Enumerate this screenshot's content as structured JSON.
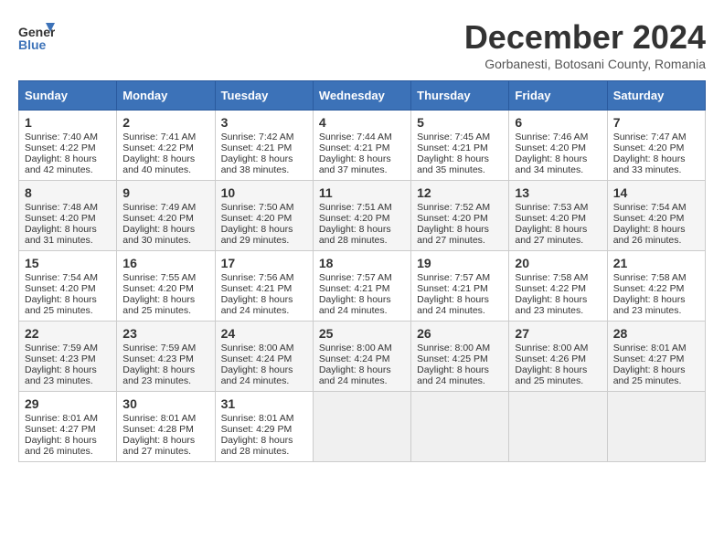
{
  "header": {
    "logo_line1": "General",
    "logo_line2": "Blue",
    "month": "December 2024",
    "location": "Gorbanesti, Botosani County, Romania"
  },
  "columns": [
    "Sunday",
    "Monday",
    "Tuesday",
    "Wednesday",
    "Thursday",
    "Friday",
    "Saturday"
  ],
  "weeks": [
    [
      {
        "day": "1",
        "lines": [
          "Sunrise: 7:40 AM",
          "Sunset: 4:22 PM",
          "Daylight: 8 hours",
          "and 42 minutes."
        ]
      },
      {
        "day": "2",
        "lines": [
          "Sunrise: 7:41 AM",
          "Sunset: 4:22 PM",
          "Daylight: 8 hours",
          "and 40 minutes."
        ]
      },
      {
        "day": "3",
        "lines": [
          "Sunrise: 7:42 AM",
          "Sunset: 4:21 PM",
          "Daylight: 8 hours",
          "and 38 minutes."
        ]
      },
      {
        "day": "4",
        "lines": [
          "Sunrise: 7:44 AM",
          "Sunset: 4:21 PM",
          "Daylight: 8 hours",
          "and 37 minutes."
        ]
      },
      {
        "day": "5",
        "lines": [
          "Sunrise: 7:45 AM",
          "Sunset: 4:21 PM",
          "Daylight: 8 hours",
          "and 35 minutes."
        ]
      },
      {
        "day": "6",
        "lines": [
          "Sunrise: 7:46 AM",
          "Sunset: 4:20 PM",
          "Daylight: 8 hours",
          "and 34 minutes."
        ]
      },
      {
        "day": "7",
        "lines": [
          "Sunrise: 7:47 AM",
          "Sunset: 4:20 PM",
          "Daylight: 8 hours",
          "and 33 minutes."
        ]
      }
    ],
    [
      {
        "day": "8",
        "lines": [
          "Sunrise: 7:48 AM",
          "Sunset: 4:20 PM",
          "Daylight: 8 hours",
          "and 31 minutes."
        ]
      },
      {
        "day": "9",
        "lines": [
          "Sunrise: 7:49 AM",
          "Sunset: 4:20 PM",
          "Daylight: 8 hours",
          "and 30 minutes."
        ]
      },
      {
        "day": "10",
        "lines": [
          "Sunrise: 7:50 AM",
          "Sunset: 4:20 PM",
          "Daylight: 8 hours",
          "and 29 minutes."
        ]
      },
      {
        "day": "11",
        "lines": [
          "Sunrise: 7:51 AM",
          "Sunset: 4:20 PM",
          "Daylight: 8 hours",
          "and 28 minutes."
        ]
      },
      {
        "day": "12",
        "lines": [
          "Sunrise: 7:52 AM",
          "Sunset: 4:20 PM",
          "Daylight: 8 hours",
          "and 27 minutes."
        ]
      },
      {
        "day": "13",
        "lines": [
          "Sunrise: 7:53 AM",
          "Sunset: 4:20 PM",
          "Daylight: 8 hours",
          "and 27 minutes."
        ]
      },
      {
        "day": "14",
        "lines": [
          "Sunrise: 7:54 AM",
          "Sunset: 4:20 PM",
          "Daylight: 8 hours",
          "and 26 minutes."
        ]
      }
    ],
    [
      {
        "day": "15",
        "lines": [
          "Sunrise: 7:54 AM",
          "Sunset: 4:20 PM",
          "Daylight: 8 hours",
          "and 25 minutes."
        ]
      },
      {
        "day": "16",
        "lines": [
          "Sunrise: 7:55 AM",
          "Sunset: 4:20 PM",
          "Daylight: 8 hours",
          "and 25 minutes."
        ]
      },
      {
        "day": "17",
        "lines": [
          "Sunrise: 7:56 AM",
          "Sunset: 4:21 PM",
          "Daylight: 8 hours",
          "and 24 minutes."
        ]
      },
      {
        "day": "18",
        "lines": [
          "Sunrise: 7:57 AM",
          "Sunset: 4:21 PM",
          "Daylight: 8 hours",
          "and 24 minutes."
        ]
      },
      {
        "day": "19",
        "lines": [
          "Sunrise: 7:57 AM",
          "Sunset: 4:21 PM",
          "Daylight: 8 hours",
          "and 24 minutes."
        ]
      },
      {
        "day": "20",
        "lines": [
          "Sunrise: 7:58 AM",
          "Sunset: 4:22 PM",
          "Daylight: 8 hours",
          "and 23 minutes."
        ]
      },
      {
        "day": "21",
        "lines": [
          "Sunrise: 7:58 AM",
          "Sunset: 4:22 PM",
          "Daylight: 8 hours",
          "and 23 minutes."
        ]
      }
    ],
    [
      {
        "day": "22",
        "lines": [
          "Sunrise: 7:59 AM",
          "Sunset: 4:23 PM",
          "Daylight: 8 hours",
          "and 23 minutes."
        ]
      },
      {
        "day": "23",
        "lines": [
          "Sunrise: 7:59 AM",
          "Sunset: 4:23 PM",
          "Daylight: 8 hours",
          "and 23 minutes."
        ]
      },
      {
        "day": "24",
        "lines": [
          "Sunrise: 8:00 AM",
          "Sunset: 4:24 PM",
          "Daylight: 8 hours",
          "and 24 minutes."
        ]
      },
      {
        "day": "25",
        "lines": [
          "Sunrise: 8:00 AM",
          "Sunset: 4:24 PM",
          "Daylight: 8 hours",
          "and 24 minutes."
        ]
      },
      {
        "day": "26",
        "lines": [
          "Sunrise: 8:00 AM",
          "Sunset: 4:25 PM",
          "Daylight: 8 hours",
          "and 24 minutes."
        ]
      },
      {
        "day": "27",
        "lines": [
          "Sunrise: 8:00 AM",
          "Sunset: 4:26 PM",
          "Daylight: 8 hours",
          "and 25 minutes."
        ]
      },
      {
        "day": "28",
        "lines": [
          "Sunrise: 8:01 AM",
          "Sunset: 4:27 PM",
          "Daylight: 8 hours",
          "and 25 minutes."
        ]
      }
    ],
    [
      {
        "day": "29",
        "lines": [
          "Sunrise: 8:01 AM",
          "Sunset: 4:27 PM",
          "Daylight: 8 hours",
          "and 26 minutes."
        ]
      },
      {
        "day": "30",
        "lines": [
          "Sunrise: 8:01 AM",
          "Sunset: 4:28 PM",
          "Daylight: 8 hours",
          "and 27 minutes."
        ]
      },
      {
        "day": "31",
        "lines": [
          "Sunrise: 8:01 AM",
          "Sunset: 4:29 PM",
          "Daylight: 8 hours",
          "and 28 minutes."
        ]
      },
      null,
      null,
      null,
      null
    ]
  ]
}
